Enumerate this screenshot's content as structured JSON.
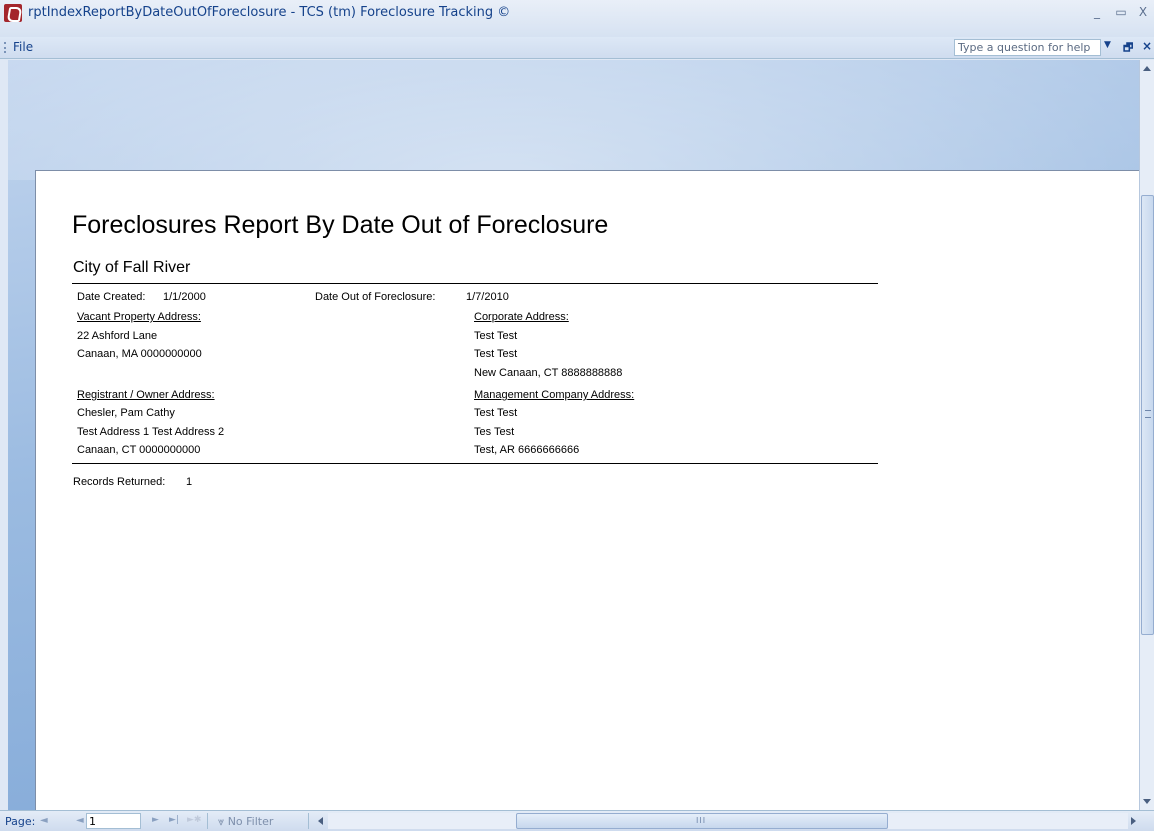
{
  "window": {
    "title": "rptIndexReportByDateOutOfForeclosure - TCS (tm) Foreclosure Tracking ©",
    "minimize_glyph": "_",
    "restore_glyph": "▭",
    "close_glyph": "X"
  },
  "menubar": {
    "file_label": "File",
    "help_placeholder": "Type a question for help",
    "help_dropdown_glyph": "▼",
    "restore_glyph": "🗗",
    "close_glyph": "×"
  },
  "report": {
    "title": "Foreclosures Report By Date Out of Foreclosure",
    "city": "City of Fall River",
    "date_created_label": "Date Created:",
    "date_created_value": "1/1/2000",
    "date_out_label": "Date Out of Foreclosure:",
    "date_out_value": "1/7/2010",
    "vacant_property": {
      "heading": "Vacant Property Address:",
      "lines": [
        "22 Ashford Lane",
        "Canaan, MA 0000000000"
      ]
    },
    "corporate": {
      "heading": "Corporate Address:",
      "lines": [
        "Test Test",
        "Test Test",
        "New Canaan, CT 8888888888"
      ]
    },
    "registrant": {
      "heading": "Registrant / Owner Address:",
      "lines": [
        "Chesler, Pam Cathy",
        "Test Address 1 Test Address 2",
        "Canaan, CT 0000000000"
      ]
    },
    "management": {
      "heading": "Management Company Address:",
      "lines": [
        "Test Test",
        "Tes Test",
        "Test, AR 6666666666"
      ]
    },
    "records_label": "Records Returned:",
    "records_value": "1"
  },
  "navigation": {
    "page_label": "Page:",
    "first_glyph": "◄",
    "prev_glyph": "◄",
    "page_value": "1",
    "next_glyph": "►",
    "last_glyph": "►|",
    "new_glyph": "►✱",
    "filter_label": "No Filter",
    "hscroll_grip": "III"
  },
  "colors": {
    "chrome_text": "#15428b",
    "workspace_blue": "#9bbbe1",
    "paper": "#ffffff"
  }
}
